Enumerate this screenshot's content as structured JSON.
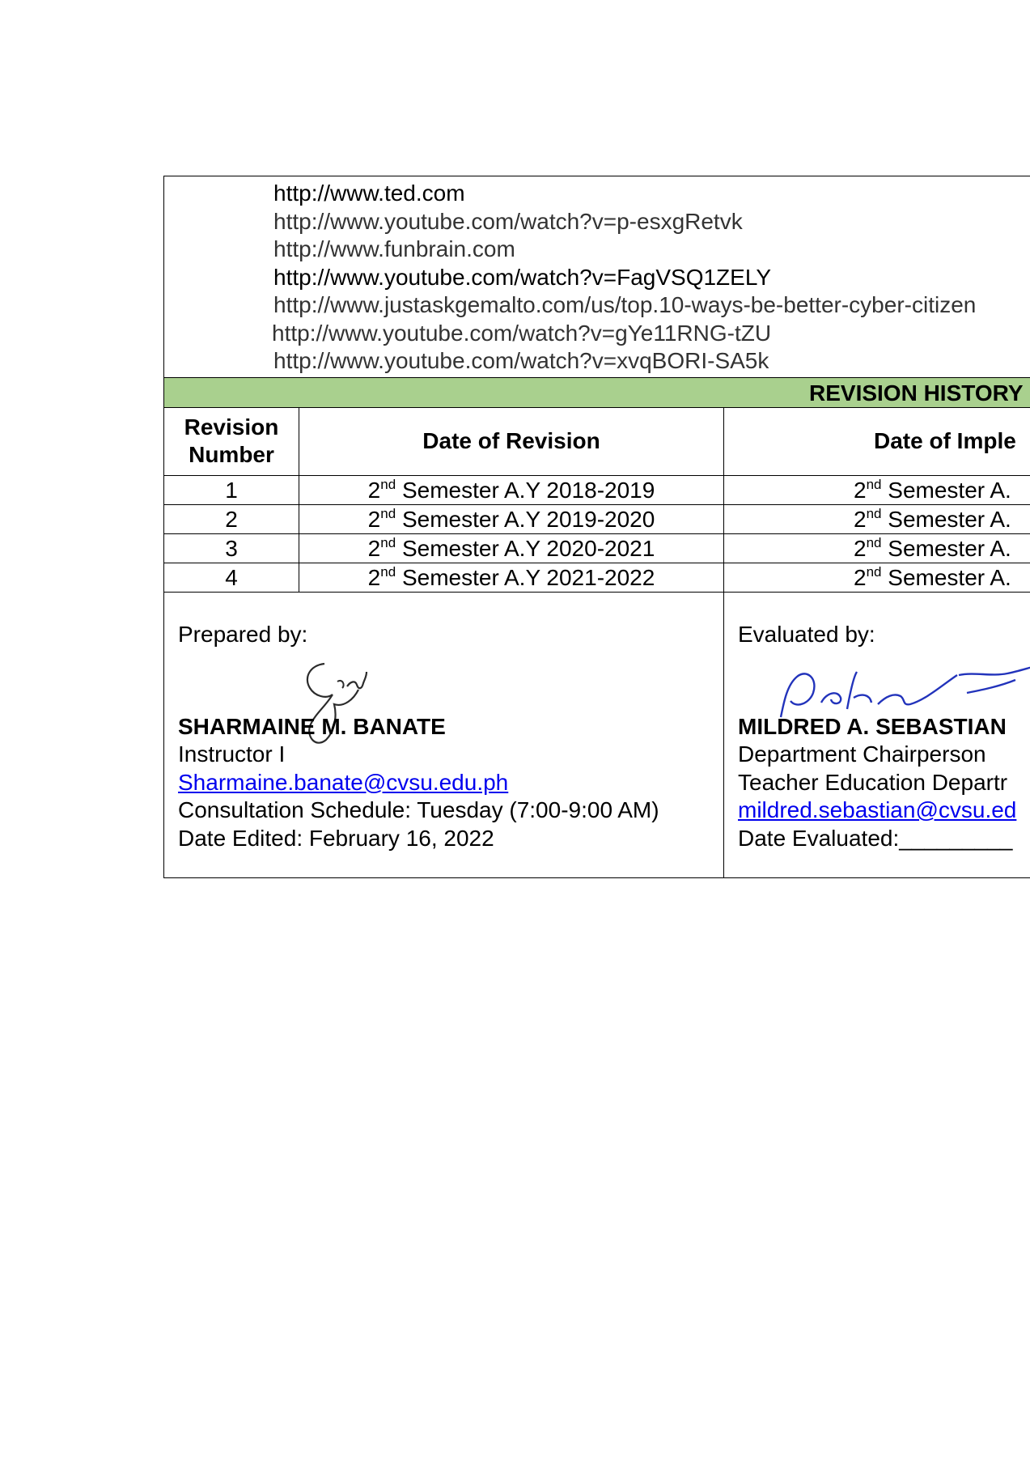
{
  "references": [
    "http://www.ted.com",
    "http://www.youtube.com/watch?v=p-esxgRetvk",
    "http://www.funbrain.com",
    "http://www.youtube.com/watch?v=FagVSQ1ZELY",
    "http://www.justaskgemalto.com/us/top.10-ways-be-better-cyber-citizen",
    "http://www.youtube.com/watch?v=gYe11RNG-tZU",
    "http://www.youtube.com/watch?v=xvqBORI-SA5k"
  ],
  "revision_history": {
    "title": "REVISION HISTORY",
    "headers": {
      "revision_number_line1": "Revision",
      "revision_number_line2": "Number",
      "date_of_revision": "Date of Revision",
      "date_of_implementation": "Date of Imple"
    },
    "ordinal": "2",
    "ordinal_suffix": "nd",
    "rows": [
      {
        "number": "1",
        "revision": "Semester A.Y 2018-2019",
        "implementation": "Semester A."
      },
      {
        "number": "2",
        "revision": "Semester A.Y 2019-2020",
        "implementation": "Semester A."
      },
      {
        "number": "3",
        "revision": "Semester A.Y 2020-2021",
        "implementation": "Semester A."
      },
      {
        "number": "4",
        "revision": "Semester A.Y 2021-2022",
        "implementation": "Semester A."
      }
    ]
  },
  "prepared": {
    "label": "Prepared by:",
    "name": "SHARMAINE M. BANATE",
    "position": "Instructor I",
    "email": "Sharmaine.banate@cvsu.edu.ph",
    "consultation": "Consultation Schedule: Tuesday (7:00-9:00 AM)",
    "date": "Date Edited: February 16, 2022"
  },
  "evaluated": {
    "label": "Evaluated by:",
    "name": "MILDRED A. SEBASTIAN",
    "position": "Department Chairperson",
    "department": "Teacher Education Departr",
    "email": "mildred.sebastian@cvsu.ed",
    "date": "Date Evaluated:_________"
  },
  "colors": {
    "header_fill": "#a9d08e",
    "link": "#0000ee",
    "signature_left": "#2b2b2b",
    "signature_right": "#2233bb"
  }
}
